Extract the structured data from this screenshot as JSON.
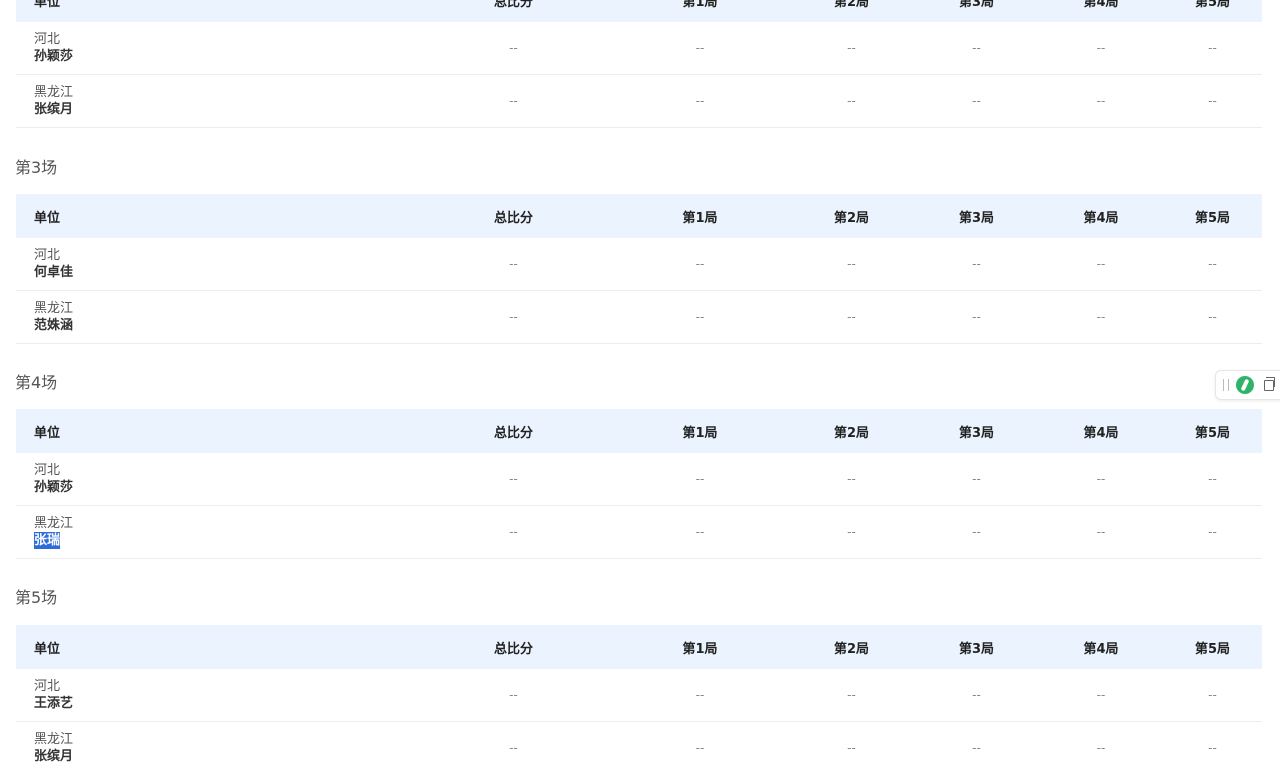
{
  "columns": [
    "单位",
    "总比分",
    "第1局",
    "第2局",
    "第3局",
    "第4局",
    "第5局"
  ],
  "matches": [
    {
      "title": "",
      "rows": [
        {
          "team": "河北",
          "player": "孙颖莎",
          "scores": [
            "--",
            "--",
            "--",
            "--",
            "--",
            "--"
          ]
        },
        {
          "team": "黑龙江",
          "player": "张缤月",
          "scores": [
            "--",
            "--",
            "--",
            "--",
            "--",
            "--"
          ]
        }
      ]
    },
    {
      "title": "第3场",
      "rows": [
        {
          "team": "河北",
          "player": "何卓佳",
          "scores": [
            "--",
            "--",
            "--",
            "--",
            "--",
            "--"
          ]
        },
        {
          "team": "黑龙江",
          "player": "范姝涵",
          "scores": [
            "--",
            "--",
            "--",
            "--",
            "--",
            "--"
          ]
        }
      ]
    },
    {
      "title": "第4场",
      "rows": [
        {
          "team": "河北",
          "player": "孙颖莎",
          "scores": [
            "--",
            "--",
            "--",
            "--",
            "--",
            "--"
          ]
        },
        {
          "team": "黑龙江",
          "player": "张瑞",
          "selected": true,
          "scores": [
            "--",
            "--",
            "--",
            "--",
            "--",
            "--"
          ]
        }
      ]
    },
    {
      "title": "第5场",
      "rows": [
        {
          "team": "河北",
          "player": "王添艺",
          "scores": [
            "--",
            "--",
            "--",
            "--",
            "--",
            "--"
          ]
        },
        {
          "team": "黑龙江",
          "player": "张缤月",
          "scores": [
            "--",
            "--",
            "--",
            "--",
            "--",
            "--"
          ]
        }
      ]
    }
  ],
  "floating_toolbar": {
    "icons": [
      "drag-handle-icon",
      "app-logo-icon",
      "copy-icon"
    ],
    "logo_color": "#2fb36b"
  },
  "colors": {
    "header_bg": "#eaf3fe",
    "selection_bg": "#2f6bd6"
  }
}
